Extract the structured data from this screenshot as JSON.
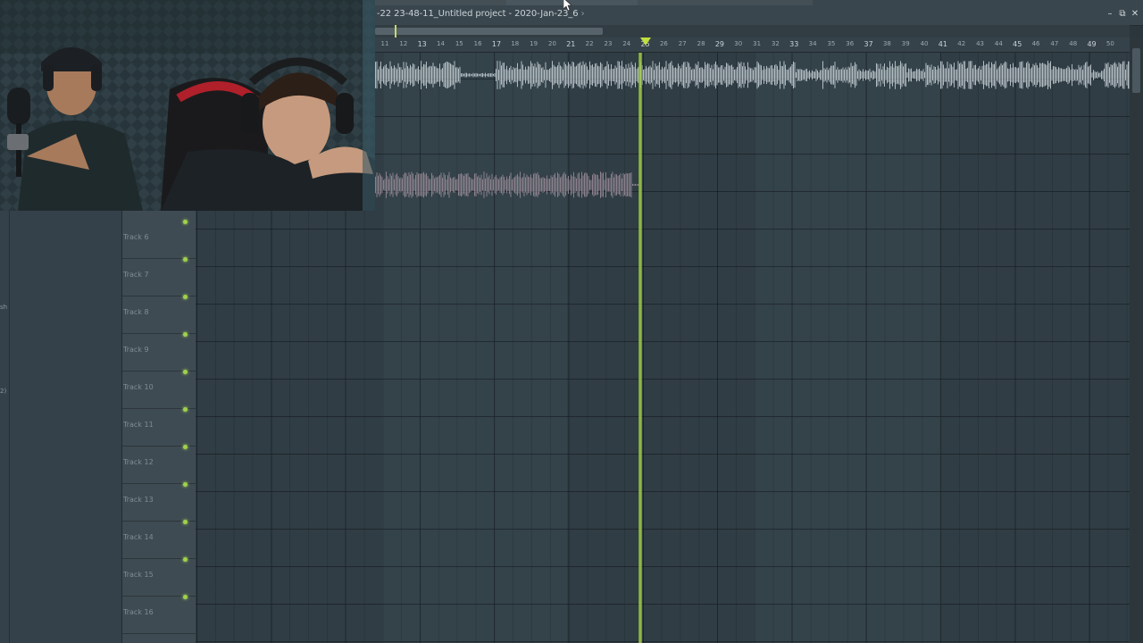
{
  "window": {
    "title": "-22 23-48-11_Untitled project - 2020-Jan-23_6",
    "title_suffix": "›",
    "minimize_label": "–",
    "maximize_label": "⧉",
    "close_label": "✕"
  },
  "ruler": {
    "ticks": [
      "11",
      "12",
      "13",
      "14",
      "15",
      "16",
      "17",
      "18",
      "19",
      "20",
      "21",
      "22",
      "23",
      "24",
      "25",
      "26",
      "27",
      "28",
      "29",
      "30",
      "31",
      "32",
      "33",
      "34",
      "35",
      "36",
      "37",
      "38",
      "39",
      "40",
      "41",
      "42",
      "43",
      "44",
      "45",
      "46",
      "47",
      "48",
      "49",
      "50"
    ],
    "major_ticks": [
      "13",
      "17",
      "21",
      "25",
      "29",
      "33",
      "37",
      "41",
      "45",
      "49"
    ],
    "playhead_bar": "25"
  },
  "tracks": [
    {
      "label": "Track 6"
    },
    {
      "label": "Track 7"
    },
    {
      "label": "Track 8"
    },
    {
      "label": "Track 9"
    },
    {
      "label": "Track 10"
    },
    {
      "label": "Track 11"
    },
    {
      "label": "Track 12"
    },
    {
      "label": "Track 13"
    },
    {
      "label": "Track 14"
    },
    {
      "label": "Track 15"
    },
    {
      "label": "Track 16"
    }
  ],
  "browser": {
    "fragments": [
      "sh",
      "2)"
    ]
  },
  "colors": {
    "playhead": "#b4dc50",
    "track_led": "#9ed24a",
    "waveform_main": "#c9d3d8",
    "waveform_secondary": "#9a8c98",
    "grid_bg": "#34424a"
  },
  "webcam": {
    "description_icon": "webcam-feed"
  }
}
